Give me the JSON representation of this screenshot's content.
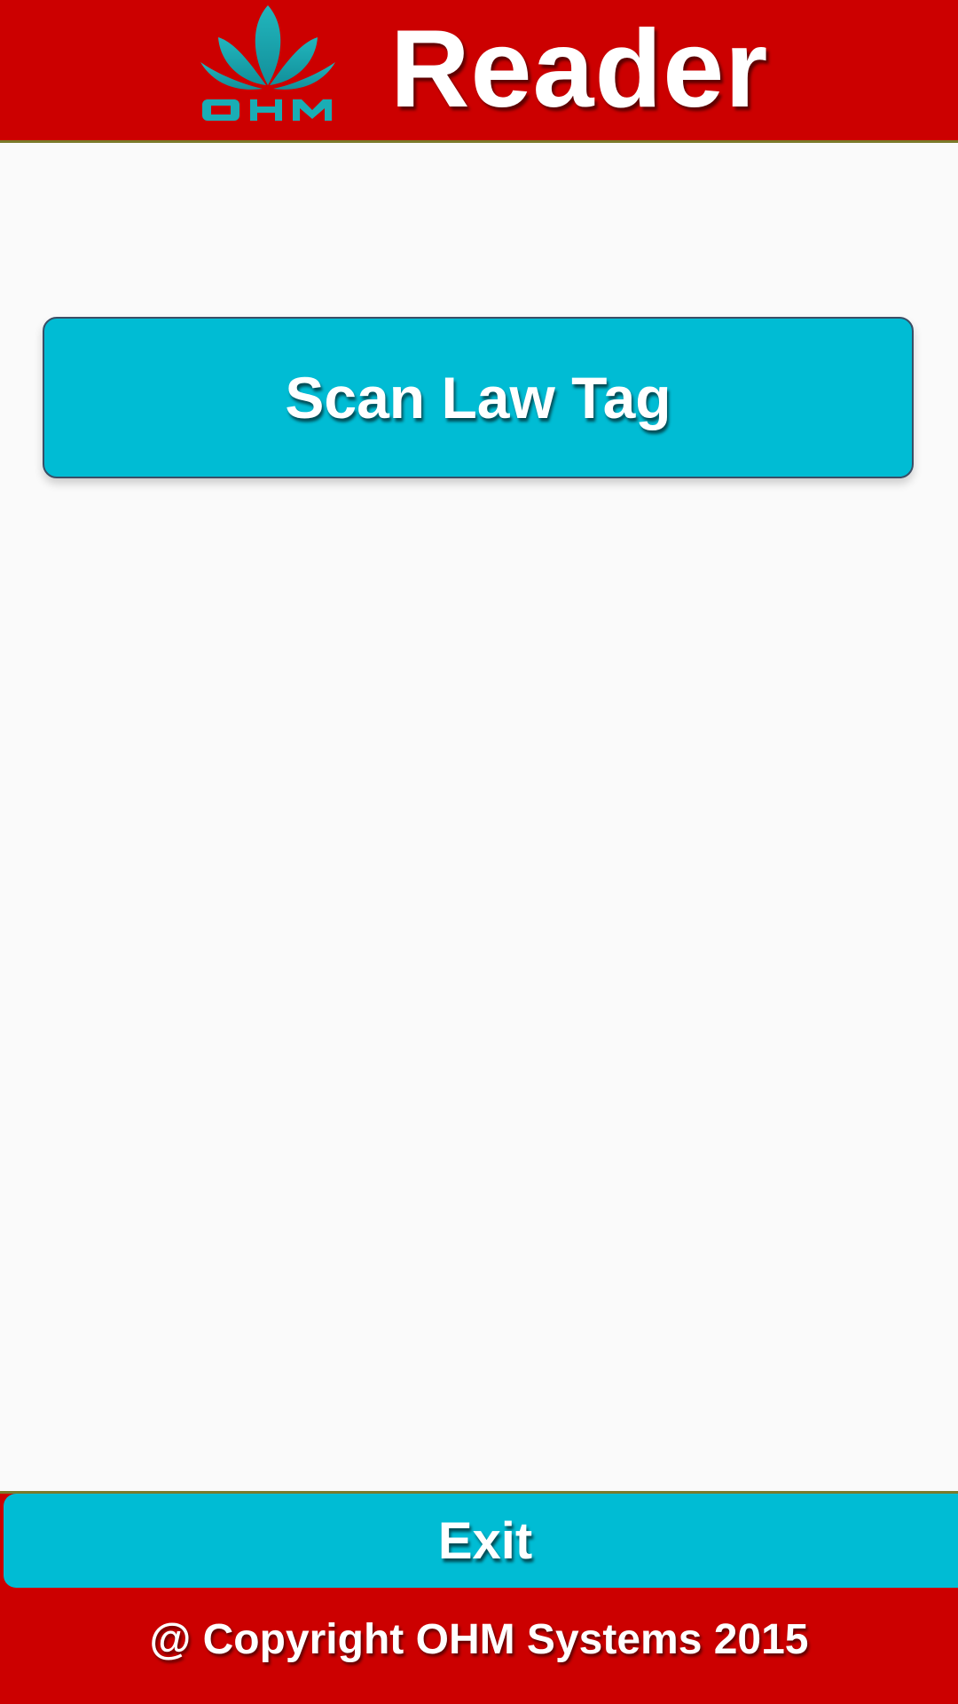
{
  "header": {
    "logo_text": "OHM",
    "logo_icon": "lotus-logo-icon",
    "title": "Reader"
  },
  "main": {
    "scan_button_label": "Scan Law Tag"
  },
  "footer": {
    "exit_button_label": "Exit",
    "copyright": "@ Copyright OHM Systems 2015"
  },
  "colors": {
    "header_background": "#cc0000",
    "button_background": "#00bcd4",
    "logo_color": "#1aadb5",
    "page_background": "#fafafa",
    "text_color": "#ffffff"
  }
}
